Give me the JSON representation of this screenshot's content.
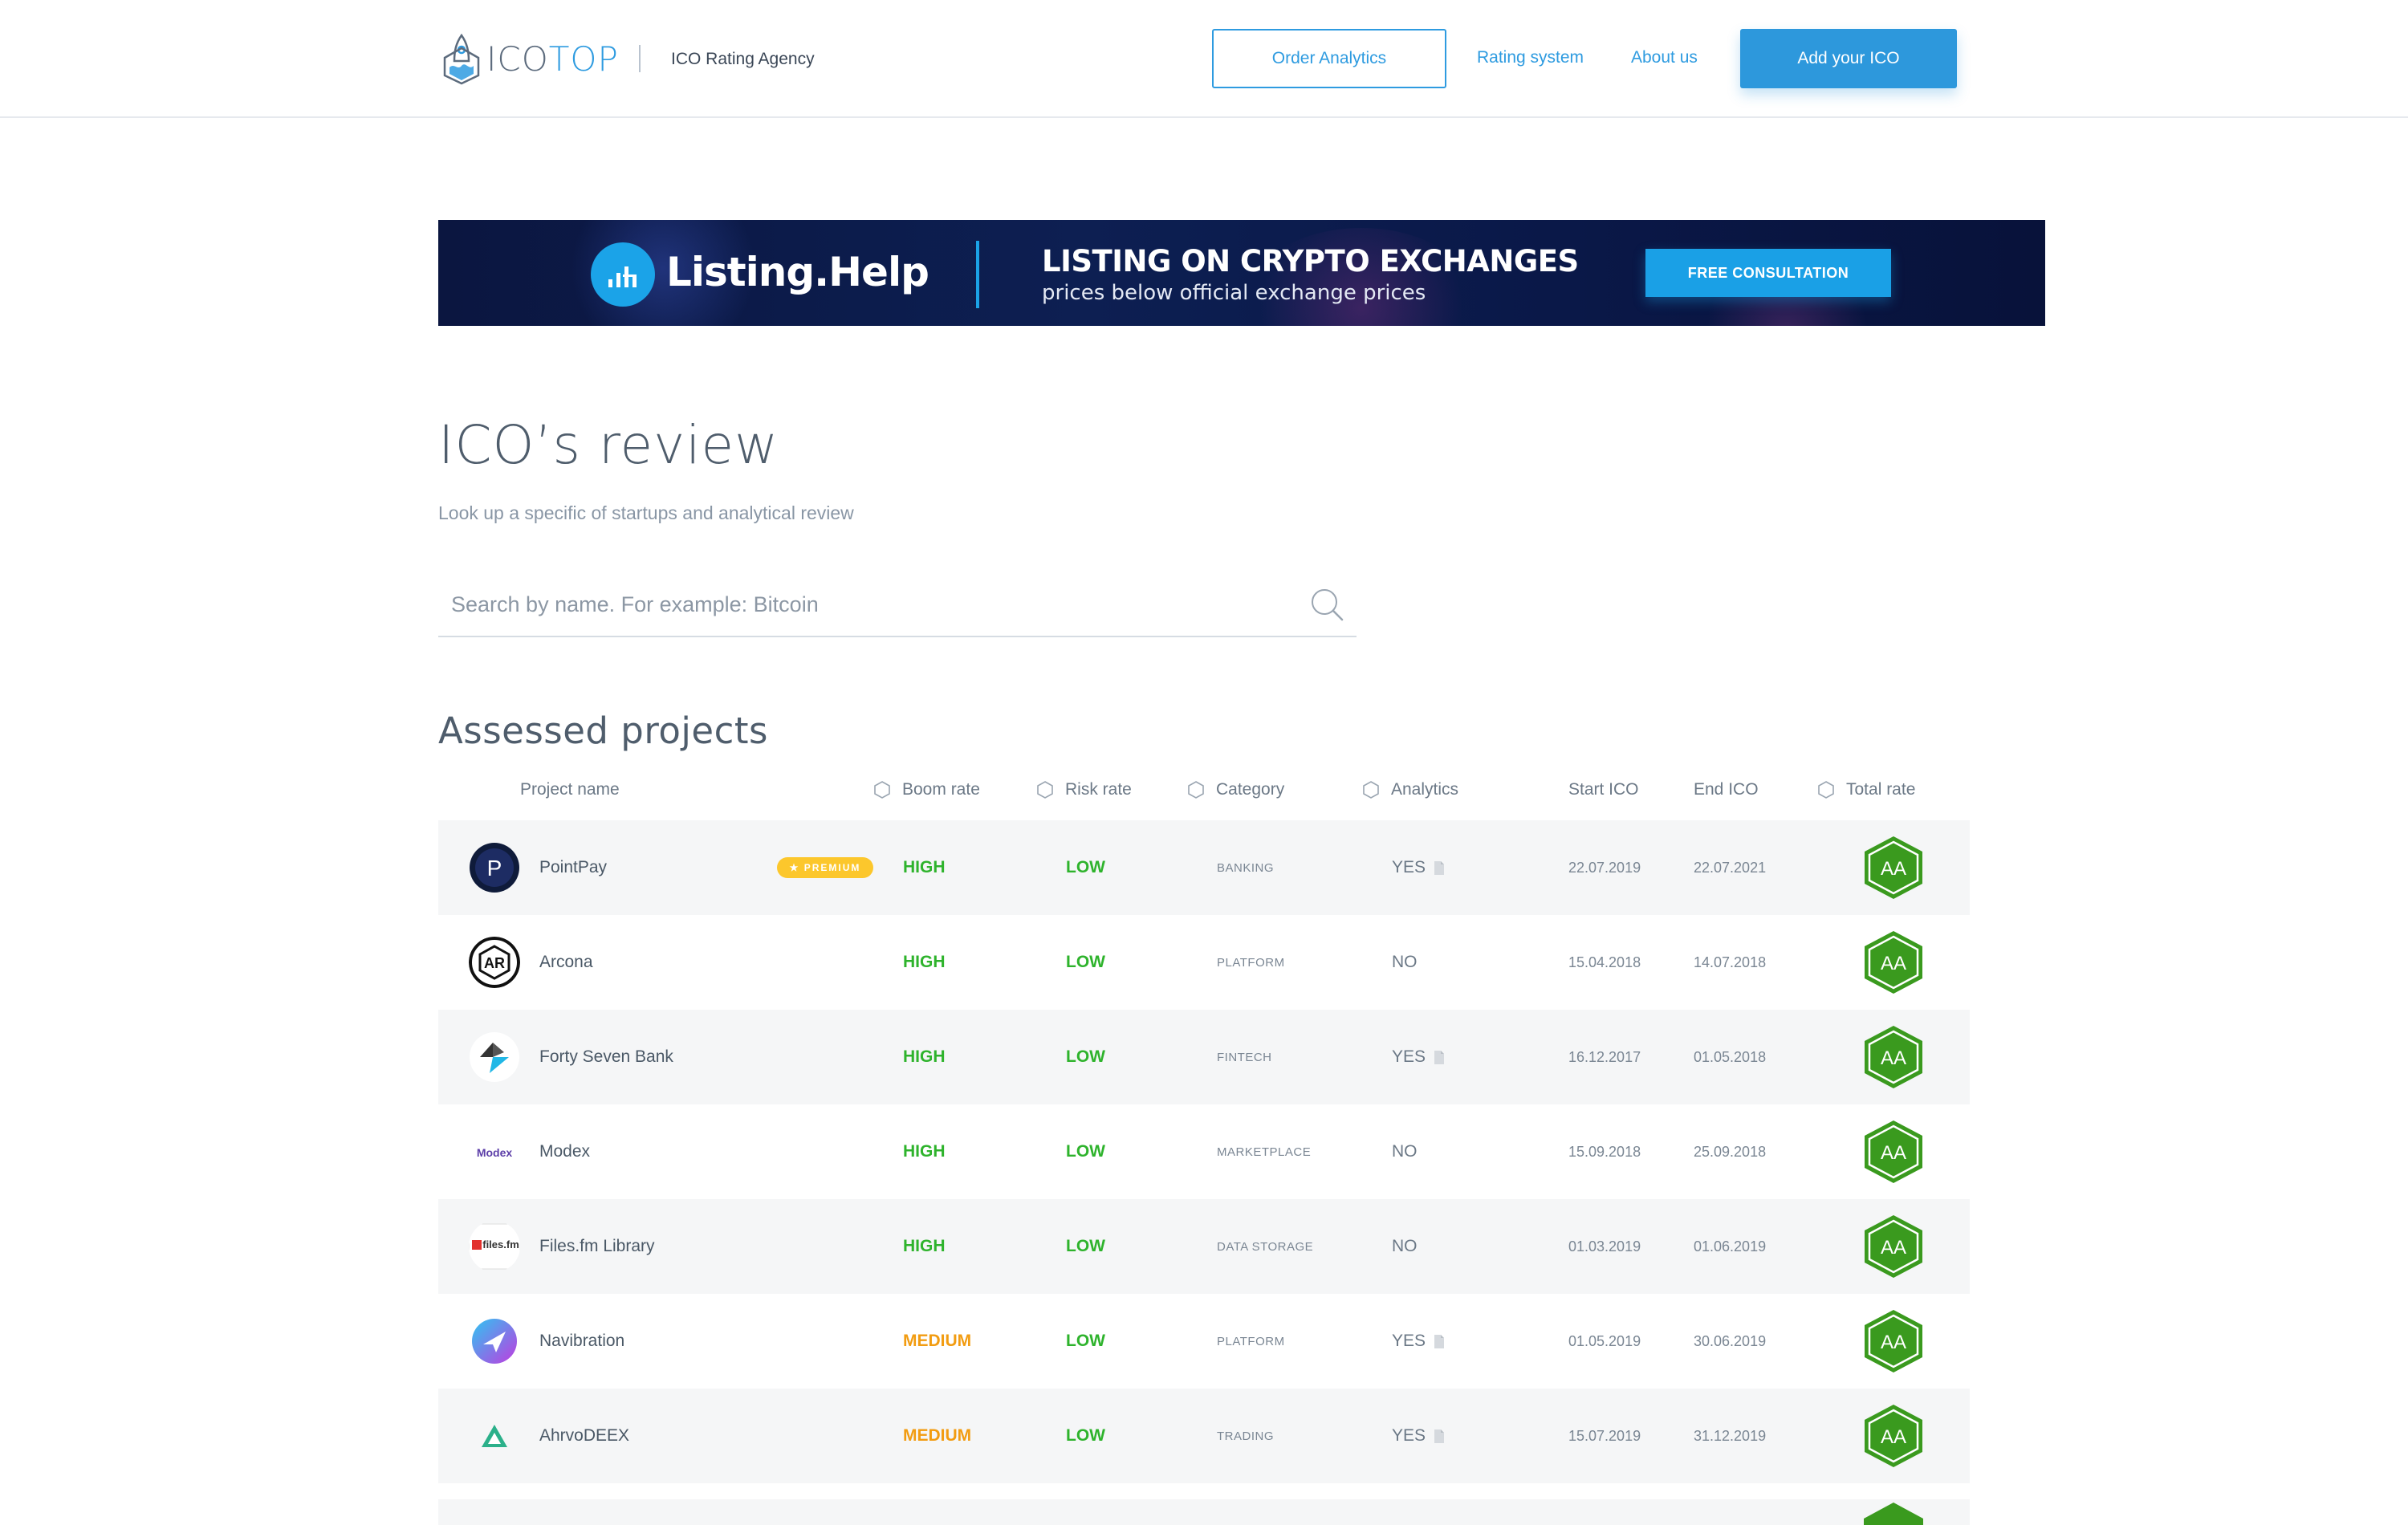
{
  "header": {
    "logo_ico": "ICO",
    "logo_top": "TOP",
    "tagline": "ICO Rating Agency",
    "order_analytics": "Order Analytics",
    "rating_system": "Rating system",
    "about_us": "About us",
    "add_ico": "Add your ICO"
  },
  "banner": {
    "brand": "Listing.Help",
    "title": "LISTING ON CRYPTO EXCHANGES",
    "subtitle": "prices below official exchange prices",
    "cta": "FREE CONSULTATION"
  },
  "review": {
    "title": "ICO’s review",
    "subtitle": "Look up a specific of startups and analytical review",
    "search_placeholder": "Search by name. For example: Bitcoin"
  },
  "assessed": {
    "title": "Assessed projects",
    "columns": {
      "project_name": "Project name",
      "boom_rate": "Boom rate",
      "risk_rate": "Risk rate",
      "category": "Category",
      "analytics": "Analytics",
      "start_ico": "Start ICO",
      "end_ico": "End ICO",
      "total_rate": "Total rate"
    },
    "premium_label": "★ PREMIUM",
    "rows": [
      {
        "name": "PointPay",
        "premium": true,
        "boom": "HIGH",
        "risk": "LOW",
        "category": "BANKING",
        "analytics": "YES",
        "start": "22.07.2019",
        "end": "22.07.2021",
        "rate": "AA",
        "logo": "pointpay-logo"
      },
      {
        "name": "Arcona",
        "premium": false,
        "boom": "HIGH",
        "risk": "LOW",
        "category": "PLATFORM",
        "analytics": "NO",
        "start": "15.04.2018",
        "end": "14.07.2018",
        "rate": "AA",
        "logo": "arcona-logo"
      },
      {
        "name": "Forty Seven Bank",
        "premium": false,
        "boom": "HIGH",
        "risk": "LOW",
        "category": "FINTECH",
        "analytics": "YES",
        "start": "16.12.2017",
        "end": "01.05.2018",
        "rate": "AA",
        "logo": "forty-seven-bank-logo"
      },
      {
        "name": "Modex",
        "premium": false,
        "boom": "HIGH",
        "risk": "LOW",
        "category": "MARKETPLACE",
        "analytics": "NO",
        "start": "15.09.2018",
        "end": "25.09.2018",
        "rate": "AA",
        "logo": "modex-logo"
      },
      {
        "name": "Files.fm Library",
        "premium": false,
        "boom": "HIGH",
        "risk": "LOW",
        "category": "DATA STORAGE",
        "analytics": "NO",
        "start": "01.03.2019",
        "end": "01.06.2019",
        "rate": "AA",
        "logo": "filesfm-logo"
      },
      {
        "name": "Navibration",
        "premium": false,
        "boom": "MEDIUM",
        "risk": "LOW",
        "category": "PLATFORM",
        "analytics": "YES",
        "start": "01.05.2019",
        "end": "30.06.2019",
        "rate": "AA",
        "logo": "navibration-logo"
      },
      {
        "name": "AhrvoDEEX",
        "premium": false,
        "boom": "MEDIUM",
        "risk": "LOW",
        "category": "TRADING",
        "analytics": "YES",
        "start": "15.07.2019",
        "end": "31.12.2019",
        "rate": "AA",
        "logo": "ahrvodeex-logo"
      }
    ]
  },
  "colors": {
    "accent": "#2e9be0",
    "high": "#2eb32c",
    "medium": "#f29c11",
    "rate_green": "#3a9a1e",
    "premium": "#fcc72c",
    "banner_bg": "#0d1f52"
  }
}
